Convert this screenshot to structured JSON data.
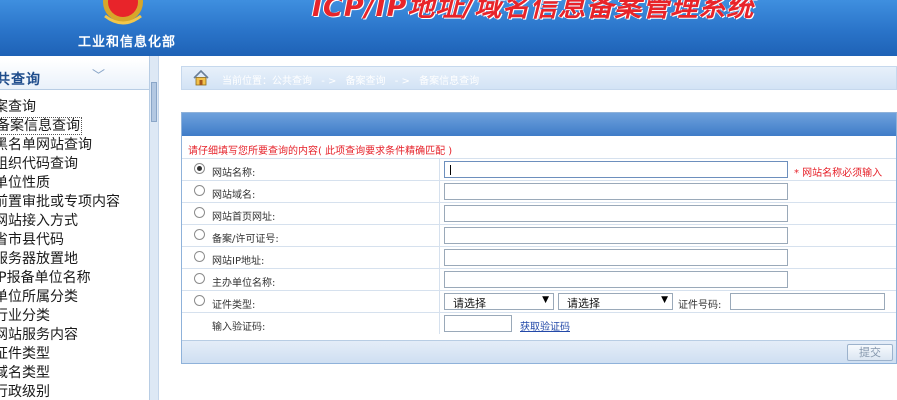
{
  "header": {
    "ministry": "工业和信息化部",
    "title": "ICP/IP地址/域名信息备案管理系统",
    "title_color": "#e8242a",
    "bar_color": "#2a74c9"
  },
  "sidebar": {
    "title": "共查询",
    "items": [
      "案查询",
      "备案信息查询",
      "黑名单网站查询",
      "组织代码查询",
      "单位性质",
      "前置审批或专项内容",
      "网站接入方式",
      "省市县代码",
      "服务器放置地",
      "IP报备单位名称",
      "单位所属分类",
      "行业分类",
      "网站服务内容",
      "证件类型",
      "域名类型",
      "行政级别"
    ],
    "active_index": 1
  },
  "breadcrumb": {
    "prefix": "当前位置：公共查询",
    "sep1": "- >",
    "level2": "备案查询",
    "sep2": "- >",
    "level3": "备案信息查询"
  },
  "form": {
    "notice": "请仔细填写您所要查询的内容( 此项查询要求条件精确匹配 )",
    "fields": [
      {
        "label": "网站名称:",
        "checked": true,
        "required_note": "* 网站名称必须输入"
      },
      {
        "label": "网站域名:"
      },
      {
        "label": "网站首页网址:"
      },
      {
        "label": "备案/许可证号:"
      },
      {
        "label": "网站IP地址:"
      },
      {
        "label": "主办单位名称:"
      },
      {
        "label": "证件类型:"
      }
    ],
    "cert_select_1": "请选择",
    "cert_select_2": "请选择",
    "cert_number_label": "证件号码:",
    "captcha_label": "输入验证码:",
    "captcha_link": "获取验证码",
    "submit": "提交"
  }
}
